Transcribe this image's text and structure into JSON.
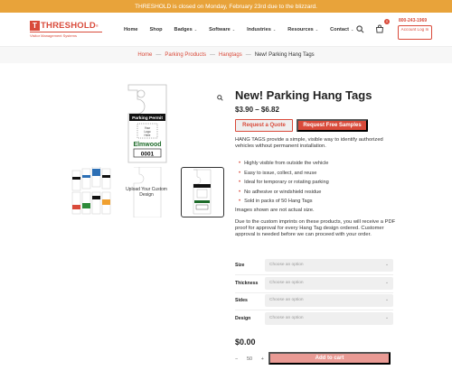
{
  "banner": {
    "text": "THRESHOLD is closed on Monday, February 23rd due to the blizzard."
  },
  "logo": {
    "mark": "T",
    "name": "THRESHOLD",
    "reg": "®",
    "tagline": "Visitor Management Systems"
  },
  "nav": {
    "items": [
      {
        "label": "Home",
        "has_dropdown": false
      },
      {
        "label": "Shop",
        "has_dropdown": false
      },
      {
        "label": "Badges",
        "has_dropdown": true
      },
      {
        "label": "Software",
        "has_dropdown": true
      },
      {
        "label": "Industries",
        "has_dropdown": true
      },
      {
        "label": "Resources",
        "has_dropdown": true
      },
      {
        "label": "Contact",
        "has_dropdown": true
      }
    ]
  },
  "header": {
    "phone": "800-243-1969",
    "account_label": "Account Log In",
    "cart_count": "0"
  },
  "breadcrumb": {
    "items": [
      "Home",
      "Parking Products",
      "Hangtags"
    ],
    "current": "New! Parking Hang Tags"
  },
  "product_image": {
    "permit_label": "Parking Permit",
    "logo_text": "Your Logo Here",
    "name": "Elmwood",
    "number": "0001"
  },
  "thumbs": {
    "upload_text": "Upload Your Custom Design"
  },
  "product": {
    "title": "New! Parking Hang Tags",
    "price": "$3.90 – $6.82",
    "quote_label": "Request a Quote",
    "samples_label": "Request Free Samples",
    "description": "HANG TAGS provide a simple, visible way to identify authorized vehicles without permanent installation.",
    "bullets": [
      "Highly visible from outside the vehicle",
      "Easy to issue, collect, and reuse",
      "Ideal for temporary or rotating parking",
      "No adhesive or windshield residue",
      "Sold in packs of 50 Hang Tags"
    ],
    "note_actual_size": "Images shown are not actual size.",
    "note_proof": "Due to the custom imprints on these products,  you will receive a PDF proof for approval for every Hang Tag design ordered. Customer approval is needed before we can proceed with your order."
  },
  "options": [
    {
      "label": "Size",
      "placeholder": "Choose an option"
    },
    {
      "label": "Thickness",
      "placeholder": "Choose an option"
    },
    {
      "label": "Sides",
      "placeholder": "Choose an option"
    },
    {
      "label": "Design",
      "placeholder": "Choose an option"
    }
  ],
  "cart": {
    "total": "$0.00",
    "quantity": "50",
    "add_label": "Add to cart"
  },
  "colors": {
    "brand": "#d94a3a",
    "banner": "#e8a33a"
  }
}
